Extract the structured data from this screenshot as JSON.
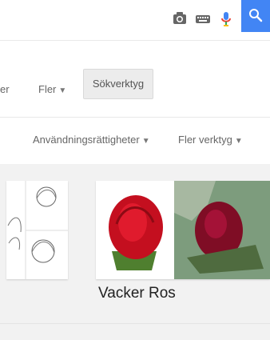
{
  "topbar": {
    "icons": [
      "camera-icon",
      "keyboard-icon",
      "mic-icon",
      "search-icon"
    ],
    "accent": "#4285f4"
  },
  "tabs": {
    "cut_label": "er",
    "more_label": "Fler",
    "tools_label": "Sökverktyg"
  },
  "tools": {
    "usage_rights": "Användningsrättigheter",
    "more_tools": "Fler verktyg"
  },
  "results": {
    "title": "Vacker Ros"
  }
}
